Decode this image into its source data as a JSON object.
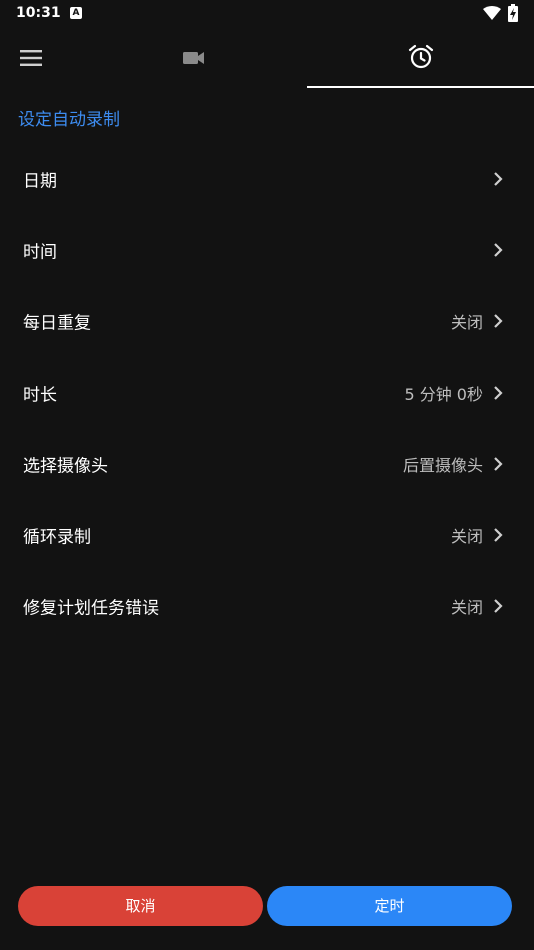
{
  "status_bar": {
    "time": "10:31",
    "notification_icon": "A"
  },
  "tabs": [
    {
      "name": "menu-icon"
    },
    {
      "name": "videocam-icon"
    },
    {
      "name": "alarm-icon",
      "active": true
    }
  ],
  "section": {
    "title": "设定自动录制"
  },
  "settings": {
    "items": [
      {
        "label": "日期",
        "value": ""
      },
      {
        "label": "时间",
        "value": ""
      },
      {
        "label": "每日重复",
        "value": "关闭"
      },
      {
        "label": "时长",
        "value": "5 分钟 0秒"
      },
      {
        "label": "选择摄像头",
        "value": "后置摄像头"
      },
      {
        "label": "循环录制",
        "value": "关闭"
      },
      {
        "label": "修复计划任务错误",
        "value": "关闭"
      }
    ]
  },
  "buttons": {
    "cancel": "取消",
    "confirm": "定时"
  },
  "colors": {
    "background": "#121212",
    "accent": "#3d8cf0",
    "cancel": "#d94237",
    "confirm": "#2b87f7"
  }
}
